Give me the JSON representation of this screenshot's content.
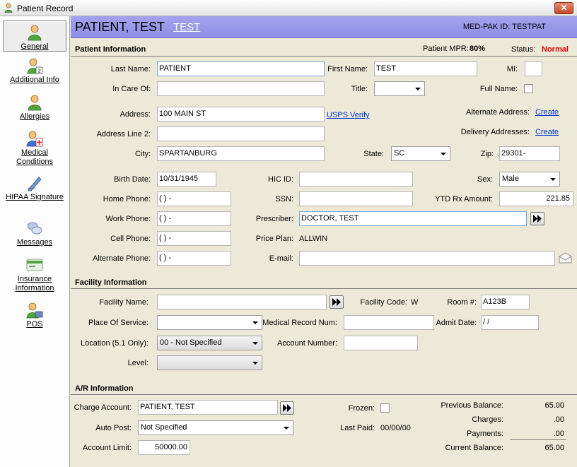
{
  "window": {
    "title": "Patient Record",
    "close_label": "✕"
  },
  "sidebar": {
    "items": [
      {
        "label": "General",
        "icon": "person-icon"
      },
      {
        "label": "Additional Info",
        "icon": "person-card-icon"
      },
      {
        "label": "Allergies",
        "icon": "person-allergy-icon"
      },
      {
        "label": "Medical Conditions",
        "icon": "medical-conditions-icon"
      },
      {
        "label": "HIPAA Signature",
        "icon": "signature-icon"
      },
      {
        "label": "Messages",
        "icon": "messages-icon"
      },
      {
        "label": "Insurance Information",
        "icon": "insurance-card-icon"
      },
      {
        "label": "POS",
        "icon": "pos-icon"
      }
    ]
  },
  "header": {
    "name": "PATIENT, TEST",
    "name_link": "TEST",
    "medpak": "MED-PAK ID: TESTPAT"
  },
  "patient_info": {
    "title": "Patient Information",
    "mpr_label": "Patient MPR:",
    "mpr_value": "80%",
    "status_label": "Status:",
    "status_value": "Normal",
    "last_name_label": "Last Name:",
    "last_name": "PATIENT",
    "first_name_label": "First Name:",
    "first_name": "TEST",
    "mi_label": "MI:",
    "mi": "",
    "in_care_of_label": "In Care Of:",
    "in_care_of": "",
    "title_label": "Title:",
    "title_value": "",
    "full_name_label": "Full Name:",
    "address_label": "Address:",
    "address": "100 MAIN ST",
    "usps_verify": "USPS Verify",
    "alt_address_label": "Alternate Address:",
    "alt_address_link": "Create",
    "address2_label": "Address Line 2:",
    "address2": "",
    "delivery_label": "Delivery Addresses:",
    "delivery_link": "Create",
    "city_label": "City:",
    "city": "SPARTANBURG",
    "state_label": "State:",
    "state": "SC",
    "zip_label": "Zip:",
    "zip": "29301-",
    "birth_label": "Birth Date:",
    "birth": "10/31/1945",
    "hic_label": "HIC ID:",
    "hic": "",
    "sex_label": "Sex:",
    "sex": "Male",
    "home_label": "Home Phone:",
    "home": "(  )   -",
    "ssn_label": "SSN:",
    "ssn": "",
    "ytd_label": "YTD Rx Amount:",
    "ytd": "221.85",
    "work_label": "Work Phone:",
    "work": "(  )   -",
    "prescriber_label": "Prescriber:",
    "prescriber": "DOCTOR, TEST",
    "cell_label": "Cell Phone:",
    "cell": "(  )   -",
    "price_label": "Price Plan:",
    "price": "ALLWIN",
    "altphone_label": "Alternate Phone:",
    "altphone": "(  )   -",
    "email_label": "E-mail:",
    "email": ""
  },
  "facility": {
    "title": "Facility Information",
    "name_label": "Facility Name:",
    "name": "",
    "code_label": "Facility Code:",
    "code": "W",
    "room_label": "Room #:",
    "room": "A123B",
    "pos_label": "Place Of Service:",
    "pos": "",
    "mrn_label": "Medical Record Num:",
    "mrn": "",
    "admit_label": "Admit Date:",
    "admit": " / /",
    "location_label": "Location (5.1 Only):",
    "location": "00 - Not Specified",
    "account_label": "Account Number:",
    "account": "",
    "level_label": "Level:",
    "level": ""
  },
  "ar": {
    "title": "A/R Information",
    "charge_label": "Charge Account:",
    "charge": "PATIENT, TEST",
    "frozen_label": "Frozen:",
    "prev_label": "Previous Balance:",
    "prev": "65.00",
    "charges_label": "Charges:",
    "charges": ".00",
    "autopost_label": "Auto Post:",
    "autopost": "Not Specified",
    "lastpaid_label": "Last Paid:",
    "lastpaid": "00/00/00",
    "payments_label": "Payments:",
    "payments": ".00",
    "limit_label": "Account Limit:",
    "limit": "50000.00",
    "current_label": "Current Balance:",
    "current": "65.00"
  }
}
